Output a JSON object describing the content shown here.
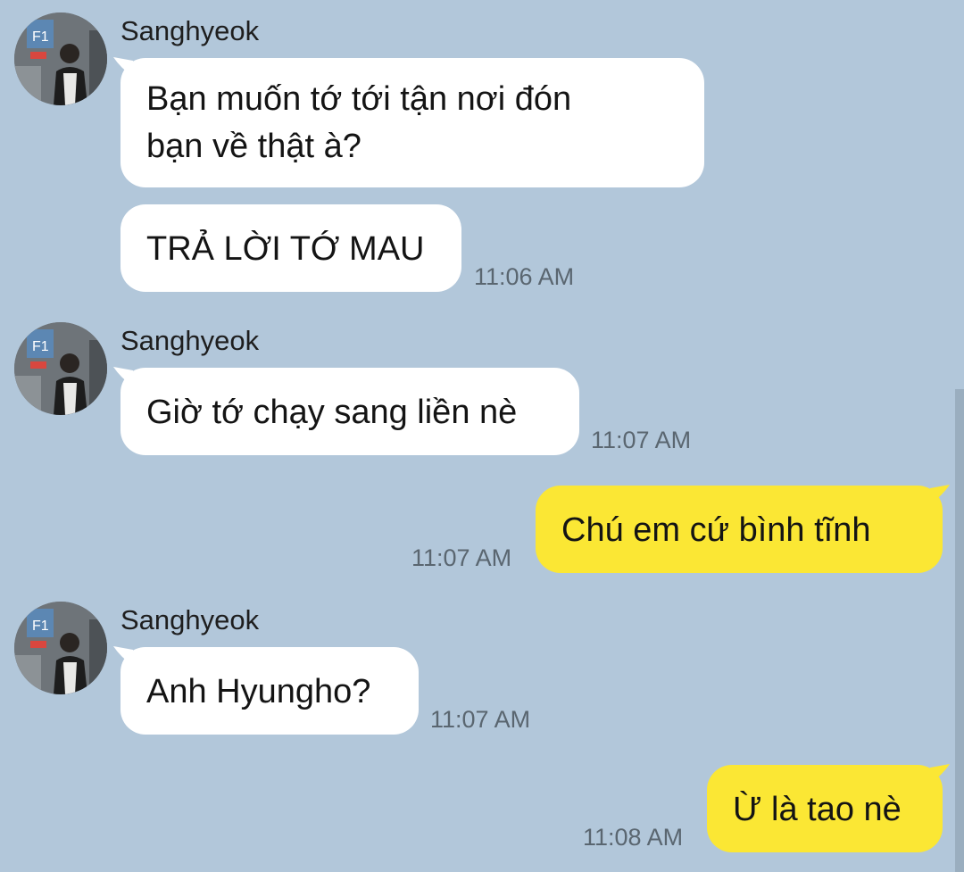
{
  "contact": {
    "name": "Sanghyeok"
  },
  "messages": [
    {
      "sender": "Sanghyeok",
      "lines": [
        "Bạn muốn tớ tới tận nơi đón",
        "bạn về thật à?"
      ],
      "time": ""
    },
    {
      "sender": "Sanghyeok",
      "lines": [
        "TRẢ LỜI TỚ MAU"
      ],
      "time": "11:06 AM"
    },
    {
      "sender": "Sanghyeok",
      "lines": [
        "Giờ tớ chạy sang liền nè"
      ],
      "time": "11:07 AM"
    },
    {
      "sender": "me",
      "lines": [
        "Chú em cứ bình tĩnh"
      ],
      "time": "11:07 AM"
    },
    {
      "sender": "Sanghyeok",
      "lines": [
        "Anh Hyungho?"
      ],
      "time": "11:07 AM"
    },
    {
      "sender": "me",
      "lines": [
        "Ừ là tao nè"
      ],
      "time": "11:08 AM"
    }
  ],
  "colors": {
    "background": "#b2c7da",
    "incoming": "#ffffff",
    "outgoing": "#fbe734"
  },
  "icons": {
    "avatar": "profile-photo"
  }
}
